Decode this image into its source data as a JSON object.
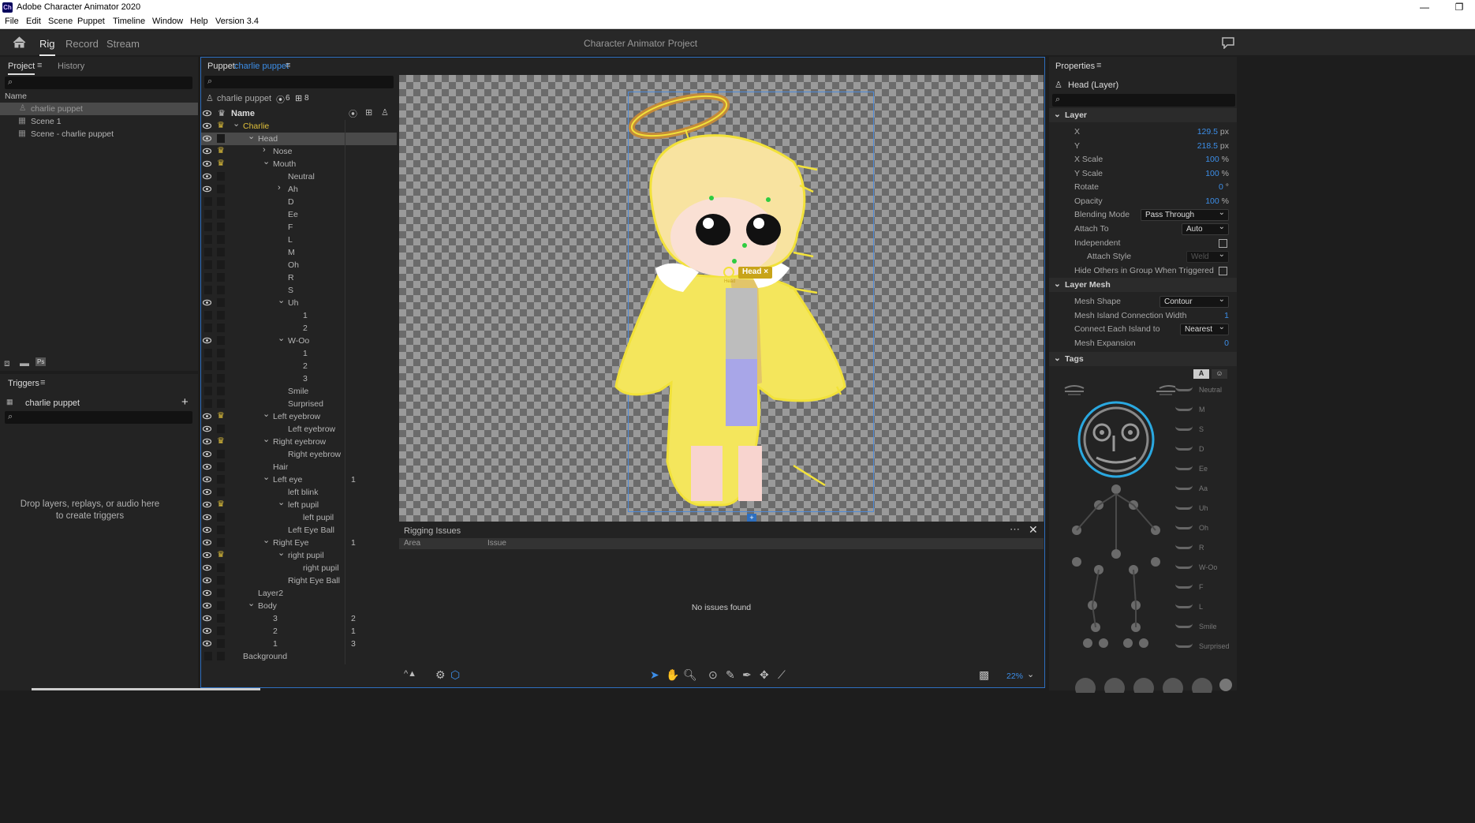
{
  "titlebar": {
    "title": "Adobe Character Animator 2020",
    "logo": "Ch"
  },
  "menu": [
    "File",
    "Edit",
    "Scene",
    "Puppet",
    "Timeline",
    "Window",
    "Help",
    "Version 3.4"
  ],
  "workspace": {
    "tabs": [
      "Rig",
      "Record",
      "Stream"
    ],
    "active": "Rig",
    "project_title": "Character Animator Project"
  },
  "project": {
    "tabs": [
      "Project",
      "History"
    ],
    "col_name": "Name",
    "items": [
      "charlie puppet",
      "Scene 1",
      "Scene - charlie puppet"
    ],
    "ps_label": "Ps"
  },
  "triggers": {
    "title": "Triggers",
    "puppet": "charlie puppet",
    "drop1": "Drop layers, replays, or audio here",
    "drop2": "to create triggers"
  },
  "puppet": {
    "label": "Puppet:",
    "name": "charlie puppet",
    "root": "charlie puppet",
    "count_a": "6",
    "count_b": "8",
    "col_name": "Name",
    "rows": [
      {
        "name": "Charlie",
        "indent": 0,
        "arrow": "v",
        "eye": true,
        "crown": true,
        "hl": true
      },
      {
        "name": "Head",
        "indent": 1,
        "arrow": "v",
        "eye": true,
        "sel": true
      },
      {
        "name": "Nose",
        "indent": 2,
        "arrow": ">",
        "eye": true,
        "crown": true
      },
      {
        "name": "Mouth",
        "indent": 2,
        "arrow": "v",
        "eye": true,
        "crown": true
      },
      {
        "name": "Neutral",
        "indent": 3,
        "arrow": "",
        "eye": true
      },
      {
        "name": "Ah",
        "indent": 3,
        "arrow": ">",
        "eye": true
      },
      {
        "name": "D",
        "indent": 3,
        "arrow": ""
      },
      {
        "name": "Ee",
        "indent": 3,
        "arrow": ""
      },
      {
        "name": "F",
        "indent": 3,
        "arrow": ""
      },
      {
        "name": "L",
        "indent": 3,
        "arrow": ""
      },
      {
        "name": "M",
        "indent": 3,
        "arrow": ""
      },
      {
        "name": "Oh",
        "indent": 3,
        "arrow": ""
      },
      {
        "name": "R",
        "indent": 3,
        "arrow": ""
      },
      {
        "name": "S",
        "indent": 3,
        "arrow": ""
      },
      {
        "name": "Uh",
        "indent": 3,
        "arrow": "v",
        "eye": true
      },
      {
        "name": "1",
        "indent": 4,
        "arrow": ""
      },
      {
        "name": "2",
        "indent": 4,
        "arrow": ""
      },
      {
        "name": "W-Oo",
        "indent": 3,
        "arrow": "v",
        "eye": true
      },
      {
        "name": "1",
        "indent": 4,
        "arrow": ""
      },
      {
        "name": "2",
        "indent": 4,
        "arrow": ""
      },
      {
        "name": "3",
        "indent": 4,
        "arrow": ""
      },
      {
        "name": "Smile",
        "indent": 3,
        "arrow": ""
      },
      {
        "name": "Surprised",
        "indent": 3,
        "arrow": ""
      },
      {
        "name": "Left eyebrow",
        "indent": 2,
        "arrow": "v",
        "eye": true,
        "crown": true
      },
      {
        "name": "Left eyebrow",
        "indent": 3,
        "arrow": "",
        "eye": true
      },
      {
        "name": "Right eyebrow",
        "indent": 2,
        "arrow": "v",
        "eye": true,
        "crown": true
      },
      {
        "name": "Right eyebrow",
        "indent": 3,
        "arrow": "",
        "eye": true
      },
      {
        "name": "Hair",
        "indent": 2,
        "arrow": "",
        "eye": true
      },
      {
        "name": "Left eye",
        "indent": 2,
        "arrow": "v",
        "eye": true,
        "n": "1"
      },
      {
        "name": "left blink",
        "indent": 3,
        "arrow": "",
        "eye": true
      },
      {
        "name": "left pupil",
        "indent": 3,
        "arrow": "v",
        "eye": true,
        "crown": true
      },
      {
        "name": "left pupil",
        "indent": 4,
        "arrow": "",
        "eye": true
      },
      {
        "name": "Left Eye Ball",
        "indent": 3,
        "arrow": "",
        "eye": true
      },
      {
        "name": "Right Eye",
        "indent": 2,
        "arrow": "v",
        "eye": true,
        "n": "1"
      },
      {
        "name": "right pupil",
        "indent": 3,
        "arrow": "v",
        "eye": true,
        "crown": true
      },
      {
        "name": "right pupil",
        "indent": 4,
        "arrow": "",
        "eye": true
      },
      {
        "name": "Right Eye Ball",
        "indent": 3,
        "arrow": "",
        "eye": true
      },
      {
        "name": "Layer2",
        "indent": 1,
        "arrow": "",
        "eye": true
      },
      {
        "name": "Body",
        "indent": 1,
        "arrow": "v",
        "eye": true
      },
      {
        "name": "3",
        "indent": 2,
        "arrow": "",
        "eye": true,
        "n": "2"
      },
      {
        "name": "2",
        "indent": 2,
        "arrow": "",
        "eye": true,
        "n": "1"
      },
      {
        "name": "1",
        "indent": 2,
        "arrow": "",
        "eye": true,
        "n": "3"
      },
      {
        "name": "Background",
        "indent": 0,
        "arrow": ""
      }
    ]
  },
  "stage": {
    "handle_label": "Head",
    "handle_small": "Head",
    "zoom": "22%"
  },
  "rigging": {
    "title": "Rigging Issues",
    "col_area": "Area",
    "col_issue": "Issue",
    "empty": "No issues found"
  },
  "properties": {
    "title": "Properties",
    "layer_title": "Head (Layer)",
    "layer_section": "Layer",
    "x_label": "X",
    "x": "129.5",
    "x_unit": "px",
    "y_label": "Y",
    "y": "218.5",
    "y_unit": "px",
    "xs_label": "X Scale",
    "xs": "100",
    "xs_unit": "%",
    "ys_label": "Y Scale",
    "ys": "100",
    "ys_unit": "%",
    "rot_label": "Rotate",
    "rot": "0",
    "rot_unit": "°",
    "op_label": "Opacity",
    "op": "100",
    "op_unit": "%",
    "blend_label": "Blending Mode",
    "blend": "Pass Through",
    "attach_label": "Attach To",
    "attach": "Auto",
    "indep_label": "Independent",
    "astyle_label": "Attach Style",
    "astyle": "Weld",
    "hide_label": "Hide Others in Group When Triggered",
    "mesh_section": "Layer Mesh",
    "shape_label": "Mesh Shape",
    "shape": "Contour",
    "conn_label": "Mesh Island Connection Width",
    "conn": "1",
    "each_label": "Connect Each Island to",
    "each": "Nearest",
    "exp_label": "Mesh Expansion",
    "exp": "0",
    "tags_section": "Tags",
    "tag_btn_a": "A",
    "mouth_tags": [
      "Neutral",
      "M",
      "S",
      "D",
      "Ee",
      "Aa",
      "Uh",
      "Oh",
      "R",
      "W-Oo",
      "F",
      "L",
      "Smile",
      "Surprised"
    ]
  },
  "colors": {
    "accent": "#3c8ee8",
    "panel": "#232323",
    "bg": "#1d1d1d",
    "yellow": "#f2e23a",
    "crown": "#e0c03a"
  }
}
